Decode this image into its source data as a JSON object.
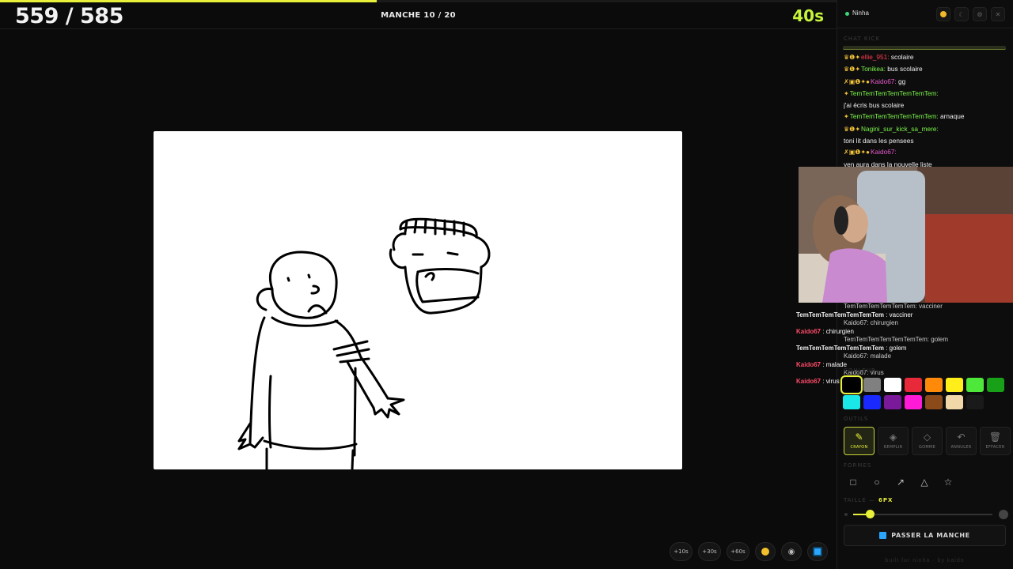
{
  "game": {
    "score": "559 / 585",
    "round": "MANCHE 10 / 20",
    "timer": "40s",
    "progress_fraction": 0.45
  },
  "bottom_tools": [
    {
      "label": "+10s"
    },
    {
      "label": "+30s"
    },
    {
      "label": "+60s"
    }
  ],
  "sidebar": {
    "streamer": "Ninha",
    "chat_label": "CHAT KICK",
    "chat": [
      {
        "user": "ellie_951",
        "text": "scolaire",
        "color": "red",
        "badges": "♛❶✦"
      },
      {
        "user": "Tonikea",
        "text": "bus scolaire",
        "color": "green",
        "badges": "♛❶✦"
      },
      {
        "user": "Kaido67",
        "text": "gg",
        "color": "pink",
        "badges": "✗▣❶✦●"
      },
      {
        "user": "TemTemTemTemTemTemTem",
        "text": "",
        "color": "green",
        "badges": "✦"
      },
      {
        "user": "",
        "text": "j'ai écris bus scolaire",
        "color": "",
        "badges": ""
      },
      {
        "user": "TemTemTemTemTemTemTem",
        "text": "arnaque",
        "color": "green",
        "badges": "✦"
      },
      {
        "user": "Nagini_sur_kick_sa_mere",
        "text": "",
        "color": "green",
        "badges": "♛❶✦"
      },
      {
        "user": "",
        "text": "toni lit dans les pensees",
        "color": "",
        "badges": ""
      },
      {
        "user": "Kaido67",
        "text": "",
        "color": "pink",
        "badges": "✗▣❶✦●"
      },
      {
        "user": "",
        "text": "yen aura dans la nouvelle liste",
        "color": "",
        "badges": ""
      }
    ],
    "overlay": [
      {
        "user": "TemTemTemTemTemTemTem",
        "text": "vacciner",
        "ghost": "TemTemTemTemTemTem: vacciner"
      },
      {
        "user": "Kaido67",
        "text": "chirurgien",
        "ghost": "Kaido67: chirurgien"
      },
      {
        "user": "TemTemTemTemTemTemTem",
        "text": "golem",
        "ghost": "TemTemTemTemTemTemTem: golem"
      },
      {
        "user": "Kaido67",
        "text": "malade",
        "ghost": "Kaido67: malade"
      },
      {
        "user": "Kaido67",
        "text": "virus",
        "ghost": "Kaido67: virus"
      }
    ],
    "colors_label": "COULEUR",
    "palette": [
      "#000000",
      "#808080",
      "#ffffff",
      "#e8293a",
      "#ff8a0a",
      "#ffee1a",
      "#4ee83a",
      "#18a018",
      "#1ae8e8",
      "#1a2aff",
      "#7a1a9a",
      "#ff1ad8",
      "#8a4a1a",
      "#f2d8a8",
      "#1a1a1a"
    ],
    "selected_color_index": 0,
    "tools_label": "OUTILS",
    "tools": [
      {
        "label": "CRAYON",
        "icon": "✎"
      },
      {
        "label": "REMPLIR",
        "icon": "◈"
      },
      {
        "label": "GOMME",
        "icon": "◇"
      },
      {
        "label": "ANNULER",
        "icon": "↶"
      },
      {
        "label": "EFFACER",
        "icon": "🗑"
      }
    ],
    "shapes_label": "FORMES",
    "shapes": [
      {
        "icon": "rectangle-icon",
        "glyph": "□"
      },
      {
        "icon": "ellipse-icon",
        "glyph": "○"
      },
      {
        "icon": "arrow-icon",
        "glyph": "↗"
      },
      {
        "icon": "triangle-icon",
        "glyph": "△"
      },
      {
        "icon": "star-icon",
        "glyph": "☆"
      }
    ],
    "size_label": "TAILLE —",
    "size_value": "6PX",
    "size_fraction": 0.12,
    "pass_button": "PASSER LA MANCHE",
    "footer": "built for ninha · by kaido"
  }
}
